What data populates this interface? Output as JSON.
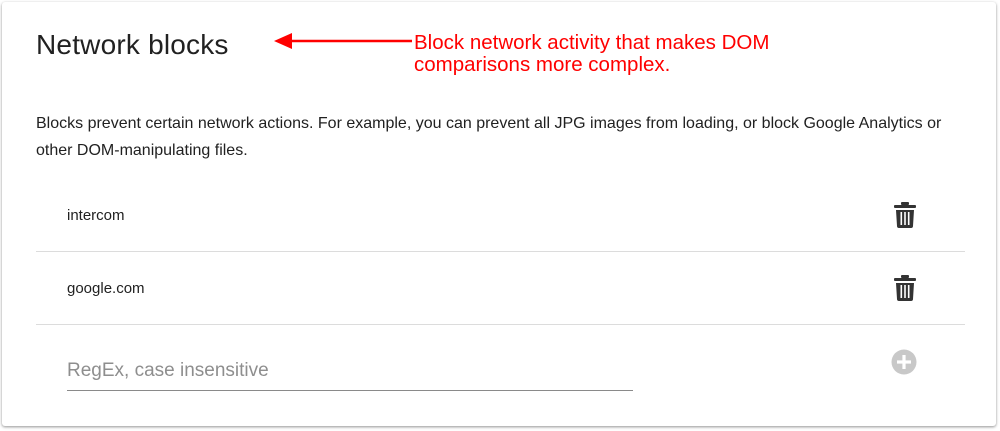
{
  "page": {
    "title": "Network blocks",
    "annotation": "Block network activity that makes DOM comparisons more complex.",
    "description": "Blocks prevent certain network actions. For example, you can prevent all JPG images from loading, or block Google Analytics or other DOM-manipulating files."
  },
  "blocks": [
    {
      "label": "intercom",
      "delete_icon": "trash-icon"
    },
    {
      "label": "google.com",
      "delete_icon": "trash-icon"
    }
  ],
  "new_block": {
    "placeholder": "RegEx, case insensitive",
    "value": "",
    "add_icon": "plus-circle-icon"
  },
  "colors": {
    "annotation": "#ff0000",
    "text": "#212121",
    "icon": "#333333",
    "add_icon": "#c8c8c8",
    "divider": "#dcdcdc"
  }
}
